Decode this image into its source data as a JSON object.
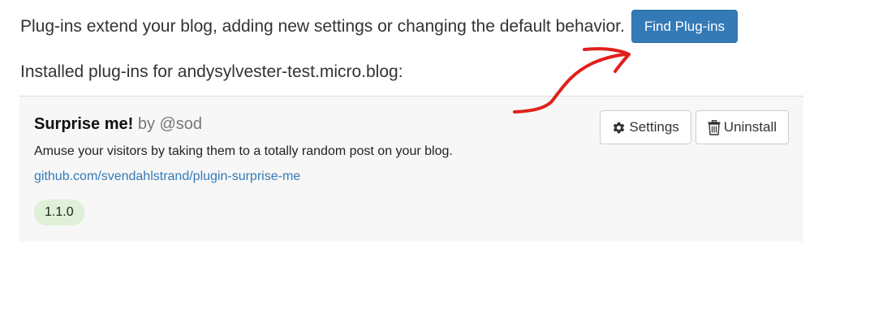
{
  "intro": {
    "text": "Plug-ins extend your blog, adding new settings or changing the default behavior.",
    "find_button": "Find Plug-ins"
  },
  "installed": {
    "heading": "Installed plug-ins for andysylvester-test.micro.blog:"
  },
  "plugins": [
    {
      "name": "Surprise me!",
      "author": "by @sod",
      "description": "Amuse your visitors by taking them to a totally random post on your blog.",
      "link": "github.com/svendahlstrand/plugin-surprise-me",
      "version": "1.1.0",
      "settings_label": "Settings",
      "uninstall_label": "Uninstall",
      "settings_icon": "gear-icon",
      "uninstall_icon": "trash-icon"
    }
  ],
  "colors": {
    "primary": "#337ab7",
    "badge_bg": "#dff0d8",
    "card_bg": "#f7f7f7",
    "annotation": "#e0201b"
  }
}
